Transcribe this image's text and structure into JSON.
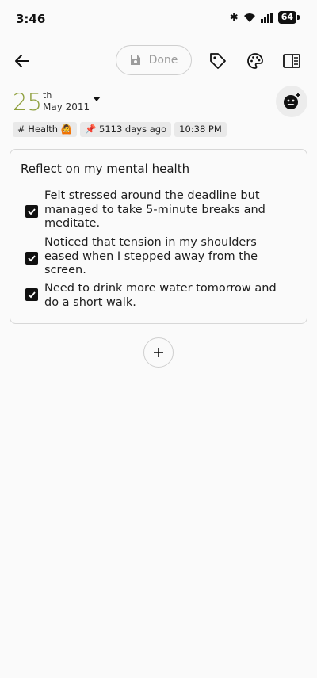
{
  "status": {
    "time": "3:46",
    "battery": "64"
  },
  "toolbar": {
    "done_label": "Done"
  },
  "entry": {
    "day": "25",
    "day_suffix": "th",
    "month_year": "May 2011"
  },
  "chips": {
    "tag": "# Health 🙆",
    "pinned": "📌 5113 days ago",
    "time": "10:38 PM"
  },
  "card": {
    "title": "Reflect on my mental health",
    "items": [
      {
        "text": "Felt stressed around the deadline but managed to take 5-minute breaks and meditate.",
        "checked": true
      },
      {
        "text": "Noticed that tension in my shoulders eased when I stepped away from the screen.",
        "checked": true
      },
      {
        "text": "Need to drink more water tomorrow and do a short walk.",
        "checked": true
      }
    ]
  },
  "colors": {
    "date_accent": "#8fa03e",
    "checkbox": "#111111"
  }
}
